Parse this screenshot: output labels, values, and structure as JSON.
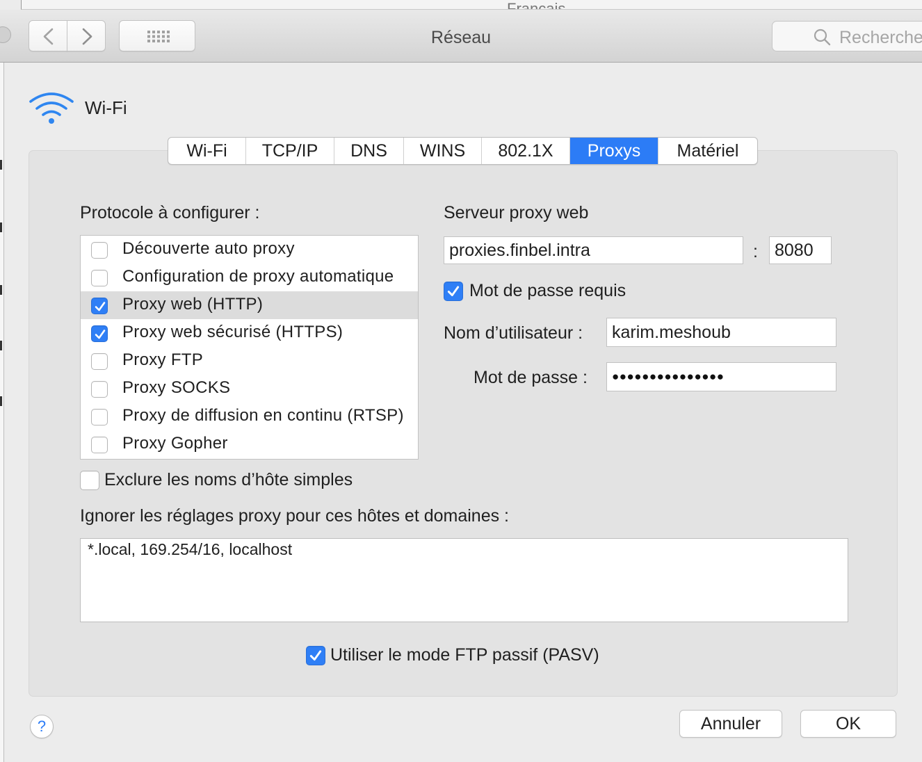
{
  "background_window": {
    "title": "Français"
  },
  "window": {
    "title": "Réseau",
    "search_placeholder": "Recherche"
  },
  "header": {
    "interface_name": "Wi-Fi"
  },
  "tabs": [
    {
      "label": "Wi-Fi",
      "active": false
    },
    {
      "label": "TCP/IP",
      "active": false
    },
    {
      "label": "DNS",
      "active": false
    },
    {
      "label": "WINS",
      "active": false
    },
    {
      "label": "802.1X",
      "active": false
    },
    {
      "label": "Proxys",
      "active": true
    },
    {
      "label": "Matériel",
      "active": false
    }
  ],
  "protocols": {
    "heading": "Protocole à configurer :",
    "items": [
      {
        "label": "Découverte auto proxy",
        "checked": false
      },
      {
        "label": "Configuration de proxy automatique",
        "checked": false
      },
      {
        "label": "Proxy web (HTTP)",
        "checked": true,
        "selected": true
      },
      {
        "label": "Proxy web sécurisé (HTTPS)",
        "checked": true
      },
      {
        "label": "Proxy FTP",
        "checked": false
      },
      {
        "label": "Proxy SOCKS",
        "checked": false
      },
      {
        "label": "Proxy de diffusion en continu (RTSP)",
        "checked": false
      },
      {
        "label": "Proxy Gopher",
        "checked": false
      }
    ]
  },
  "server": {
    "heading": "Serveur proxy web",
    "host": "proxies.finbel.intra",
    "separator": ":",
    "port": "8080",
    "password_required_label": "Mot de passe requis",
    "password_required": true,
    "username_label": "Nom d’utilisateur :",
    "username": "karim.meshoub",
    "password_label": "Mot de passe :",
    "password_masked": "●●●●●●●●●●●●●●●"
  },
  "exclude_simple": {
    "label": "Exclure les noms d’hôte simples",
    "checked": false
  },
  "bypass": {
    "label": "Ignorer les réglages proxy pour ces hôtes et domaines :",
    "value": "*.local, 169.254/16, localhost"
  },
  "passive_ftp": {
    "label": "Utiliser le mode FTP passif (PASV)",
    "checked": true
  },
  "buttons": {
    "help": "?",
    "cancel": "Annuler",
    "ok": "OK"
  },
  "colors": {
    "accent": "#2c7cf6",
    "pane": "#e3e3e3",
    "window": "#ececec"
  }
}
